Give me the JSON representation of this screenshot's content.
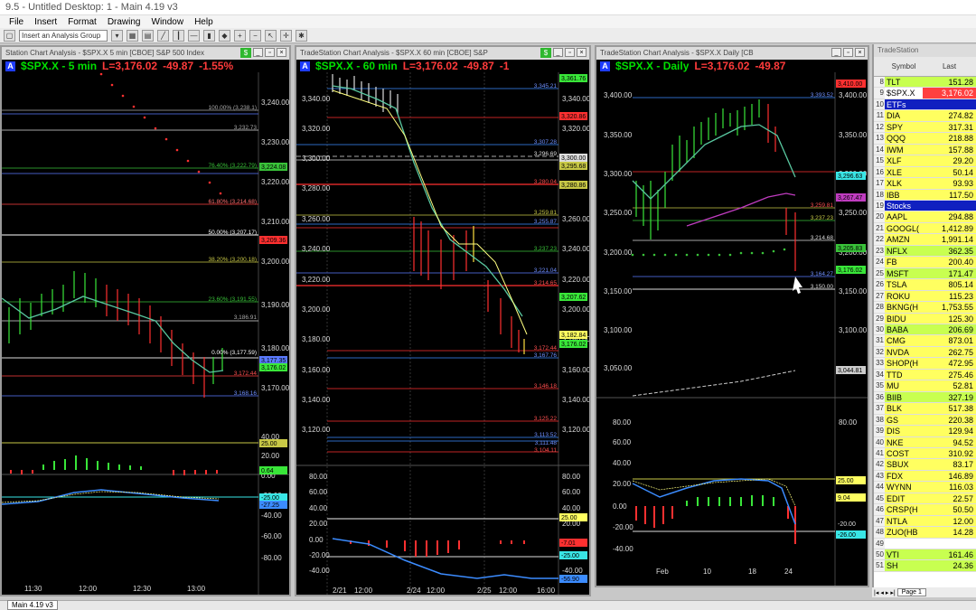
{
  "window_title": "9.5 - Untitled Desktop: 1 - Main 4.19 v3",
  "menu": [
    "File",
    "Insert",
    "Format",
    "Drawing",
    "Window",
    "Help"
  ],
  "toolbar": {
    "analysis_group_placeholder": "Insert an Analysis Group"
  },
  "charts": [
    {
      "window_title": "Station Chart Analysis - $SPX.X 5 min [CBOE] S&P 500 Index",
      "symbol": "$SPX.X - 5 min",
      "last": "L=3,176.02",
      "change": "-49.87",
      "pct": "-1.55%",
      "price_axis": [
        "3,240.00",
        "3,230.00",
        "3,220.00",
        "3,210.00",
        "3,200.00",
        "3,190.00",
        "3,180.00",
        "3,170.00"
      ],
      "fib_labels": [
        "100.00% (3,238.1)",
        "76.40% (3,222.79)",
        "61.80% (3,214.68)",
        "50.00% (3,207.17)",
        "38.20% (3,200.18)",
        "23.60% (3,191.55)",
        "0.00% (3,177.59)"
      ],
      "line_labels": [
        "3,232.73",
        "3,186.91",
        "3,172.44",
        "3,168.16"
      ],
      "price_tags": [
        "3,224.08",
        "3,209.36",
        "3,177.35",
        "3,176.02"
      ],
      "osc_axis": [
        "40.00",
        "20.00",
        "0.00",
        "-20.00",
        "-40.00",
        "-60.00",
        "-80.00"
      ],
      "osc_tags": [
        "25.00",
        "0.64",
        "-25.00",
        "-27.25"
      ],
      "time_axis": [
        "11:30",
        "12:00",
        "12:30",
        "13:00"
      ]
    },
    {
      "window_title": "TradeStation Chart Analysis - $SPX.X 60 min [CBOE] S&P",
      "symbol": "$SPX.X - 60 min",
      "last": "L=3,176.02",
      "change": "-49.87",
      "pct": "-1",
      "price_axis": [
        "3,340.00",
        "3,320.00",
        "3,300.00",
        "3,280.00",
        "3,260.00",
        "3,240.00",
        "3,220.00",
        "3,200.00",
        "3,180.00",
        "3,160.00",
        "3,140.00",
        "3,120.00"
      ],
      "line_labels": [
        "3,345.21",
        "3,307.28",
        "3,296.69",
        "3,280.04",
        "3,259.81",
        "3,255.87",
        "3,237.23",
        "3,221.04",
        "3,214.65",
        "3,172.44",
        "3,167.76",
        "3,146.18",
        "3,125.22",
        "3,113.52",
        "3,111.48",
        "3,104.11"
      ],
      "price_tags": [
        "3,361.76",
        "3,320.86",
        "3,300.00",
        "3,295.68",
        "3,280.86",
        "3,207.62",
        "3,182.84",
        "3,176.02"
      ],
      "osc_axis": [
        "80.00",
        "60.00",
        "40.00",
        "20.00",
        "0.00",
        "-20.00",
        "-40.00"
      ],
      "osc_tags": [
        "25.00",
        "-7.01",
        "-25.00",
        "-56.90"
      ],
      "time_axis": [
        "2/21",
        "12:00",
        "2/24",
        "12:00",
        "2/25",
        "12:00",
        "16:00"
      ]
    },
    {
      "window_title": "TradeStation Chart Analysis - $SPX.X Daily [CB",
      "symbol": "$SPX.X - Daily",
      "last": "L=3,176.02",
      "change": "-49.87",
      "pct": "",
      "price_axis": [
        "3,400.00",
        "3,350.00",
        "3,300.00",
        "3,250.00",
        "3,200.00",
        "3,150.00",
        "3,100.00",
        "3,050.00"
      ],
      "line_labels": [
        "3,393.52",
        "3,259.81",
        "3,237.23",
        "3,214.68",
        "3,164.27",
        "3,150.00"
      ],
      "price_tags": [
        "3,410.00",
        "3,296.63",
        "3,267.47",
        "3,205.83",
        "3,176.02",
        "3,044.81"
      ],
      "osc_axis": [
        "80.00",
        "60.00",
        "40.00",
        "20.00",
        "0.00",
        "-20.00",
        "-40.00"
      ],
      "osc_tags": [
        "25.00",
        "9.04",
        "-20.00",
        "-26.00"
      ],
      "time_axis": [
        "Feb",
        "10",
        "18",
        "24"
      ]
    }
  ],
  "radarscreen": {
    "title": "TradeStation",
    "columns": {
      "symbol": "Symbol",
      "last": "Last"
    },
    "rows": [
      {
        "n": "8",
        "sym": "TLT",
        "last": "151.28",
        "bg": "#c8ff50"
      },
      {
        "n": "9",
        "sym": "$SPX.X",
        "last": "3,176.02",
        "bg": "#ff4040"
      },
      {
        "n": "10",
        "sym": "ETFs",
        "last": "",
        "bg": "#1020c0",
        "header": true
      },
      {
        "n": "11",
        "sym": "DIA",
        "last": "274.82",
        "bg": "#ffff60"
      },
      {
        "n": "12",
        "sym": "SPY",
        "last": "317.31",
        "bg": "#ffff60"
      },
      {
        "n": "13",
        "sym": "QQQ",
        "last": "218.88",
        "bg": "#ffff60"
      },
      {
        "n": "14",
        "sym": "IWM",
        "last": "157.88",
        "bg": "#ffff60"
      },
      {
        "n": "15",
        "sym": "XLF",
        "last": "29.20",
        "bg": "#ffff60"
      },
      {
        "n": "16",
        "sym": "XLE",
        "last": "50.14",
        "bg": "#ffff60"
      },
      {
        "n": "17",
        "sym": "XLK",
        "last": "93.93",
        "bg": "#ffff60"
      },
      {
        "n": "18",
        "sym": "IBB",
        "last": "117.50",
        "bg": "#ffff60"
      },
      {
        "n": "19",
        "sym": "Stocks",
        "last": "",
        "bg": "#1020c0",
        "header": true
      },
      {
        "n": "20",
        "sym": "AAPL",
        "last": "294.88",
        "bg": "#ffff60"
      },
      {
        "n": "21",
        "sym": "GOOGL(",
        "last": "1,412.89",
        "bg": "#ffff60"
      },
      {
        "n": "22",
        "sym": "AMZN",
        "last": "1,991.14",
        "bg": "#ffff60"
      },
      {
        "n": "23",
        "sym": "NFLX",
        "last": "362.35",
        "bg": "#c8ff50"
      },
      {
        "n": "24",
        "sym": "FB",
        "last": "200.40",
        "bg": "#ffff60"
      },
      {
        "n": "25",
        "sym": "MSFT",
        "last": "171.47",
        "bg": "#c8ff50"
      },
      {
        "n": "26",
        "sym": "TSLA",
        "last": "805.14",
        "bg": "#ffff60"
      },
      {
        "n": "27",
        "sym": "ROKU",
        "last": "115.23",
        "bg": "#ffff60"
      },
      {
        "n": "28",
        "sym": "BKNG(H",
        "last": "1,753.55",
        "bg": "#ffff60"
      },
      {
        "n": "29",
        "sym": "BIDU",
        "last": "125.30",
        "bg": "#ffff60"
      },
      {
        "n": "30",
        "sym": "BABA",
        "last": "206.69",
        "bg": "#c8ff50"
      },
      {
        "n": "31",
        "sym": "CMG",
        "last": "873.01",
        "bg": "#ffff60"
      },
      {
        "n": "32",
        "sym": "NVDA",
        "last": "262.75",
        "bg": "#ffff60"
      },
      {
        "n": "33",
        "sym": "SHOP(H",
        "last": "472.95",
        "bg": "#ffff60"
      },
      {
        "n": "34",
        "sym": "TTD",
        "last": "275.46",
        "bg": "#ffff60"
      },
      {
        "n": "35",
        "sym": "MU",
        "last": "52.81",
        "bg": "#ffff60"
      },
      {
        "n": "36",
        "sym": "BIIB",
        "last": "327.19",
        "bg": "#c8ff50"
      },
      {
        "n": "37",
        "sym": "BLK",
        "last": "517.38",
        "bg": "#ffff60"
      },
      {
        "n": "38",
        "sym": "GS",
        "last": "220.38",
        "bg": "#ffff60"
      },
      {
        "n": "39",
        "sym": "DIS",
        "last": "129.94",
        "bg": "#ffff60"
      },
      {
        "n": "40",
        "sym": "NKE",
        "last": "94.52",
        "bg": "#ffff60"
      },
      {
        "n": "41",
        "sym": "COST",
        "last": "310.92",
        "bg": "#ffff60"
      },
      {
        "n": "42",
        "sym": "SBUX",
        "last": "83.17",
        "bg": "#ffff60"
      },
      {
        "n": "43",
        "sym": "FDX",
        "last": "146.89",
        "bg": "#ffff60"
      },
      {
        "n": "44",
        "sym": "WYNN",
        "last": "116.03",
        "bg": "#ffff60"
      },
      {
        "n": "45",
        "sym": "EDIT",
        "last": "22.57",
        "bg": "#ffff60"
      },
      {
        "n": "46",
        "sym": "CRSP(H",
        "last": "50.50",
        "bg": "#ffff60"
      },
      {
        "n": "47",
        "sym": "NTLA",
        "last": "12.00",
        "bg": "#ffff60"
      },
      {
        "n": "48",
        "sym": "ZUO(HB",
        "last": "14.28",
        "bg": "#ffff60"
      },
      {
        "n": "49",
        "sym": "",
        "last": "",
        "bg": "#ffffff"
      },
      {
        "n": "50",
        "sym": "VTI",
        "last": "161.46",
        "bg": "#c8ff50"
      },
      {
        "n": "51",
        "sym": "SH",
        "last": "24.36",
        "bg": "#c8ff50"
      }
    ],
    "sheet_tab": "Page 1"
  },
  "status_tab": "Main 4.19 v3"
}
